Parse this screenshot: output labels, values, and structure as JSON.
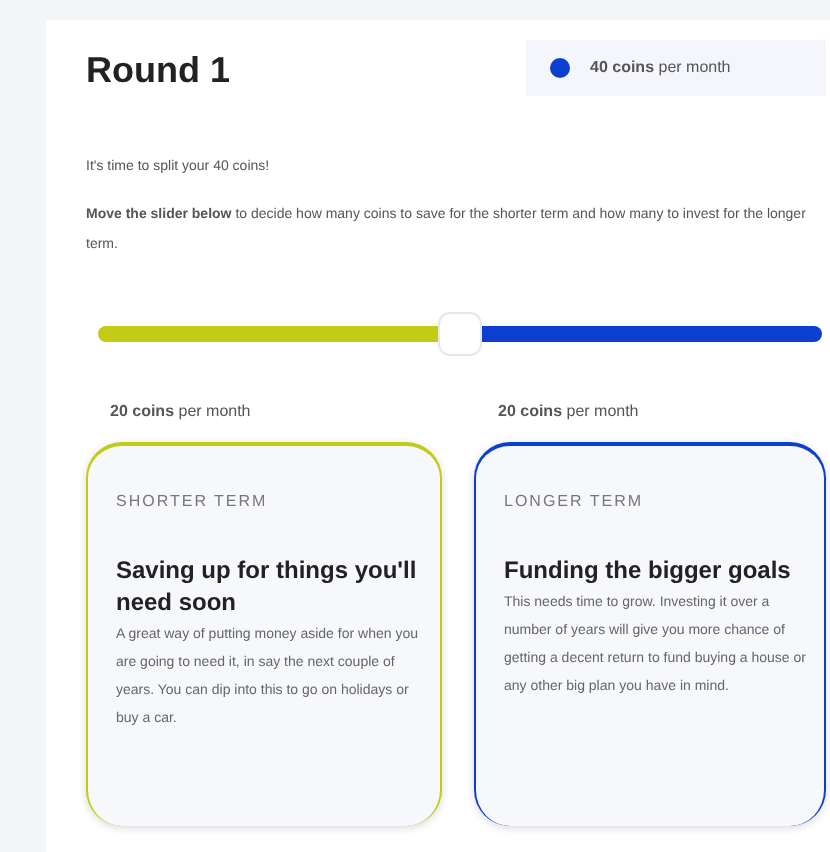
{
  "title": "Round 1",
  "total_badge": {
    "text": "**40 coins** per month",
    "color": "#0a3fd0"
  },
  "intro": "It's time to split your 40 coins!",
  "instructions": "**Move the slider below** to decide how many coins to save for the shorter term and how many to invest for the longer term.",
  "slider": {
    "level": 0.5
  },
  "options": [
    {
      "amount": "**20 coins** per month",
      "label": "SHORTER TERM",
      "heading": "Saving up for things you'll need soon",
      "body": "A great way of putting money aside for when you are going to need it, in say the next couple of years. You can dip into this to go on holidays or buy a car.",
      "color": "#c2cc14"
    },
    {
      "amount": "**20 coins** per month",
      "label": "LONGER TERM",
      "heading": "Funding the bigger goals",
      "body": "This needs time to grow. Investing it over a number of years will give you more chance of getting a decent return to fund buying a house or any other big plan you have in mind.",
      "color": "#0a3fd0"
    }
  ]
}
